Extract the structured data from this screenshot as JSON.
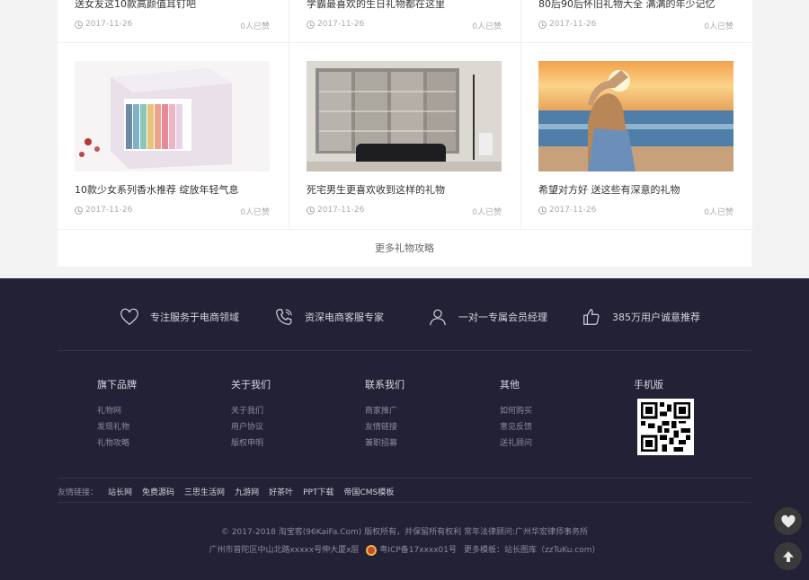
{
  "top_row": [
    {
      "title": "送女友这10款高颜值耳钉吧",
      "date": "2017-11-26",
      "likes": "0人已赞"
    },
    {
      "title": "学霸最喜欢的生日礼物都在这里",
      "date": "2017-11-26",
      "likes": "0人已赞"
    },
    {
      "title": "80后90后怀旧礼物大全 满满的年少记忆",
      "date": "2017-11-26",
      "likes": "0人已赞"
    }
  ],
  "cards": [
    {
      "title": "10款少女系列香水推荐 绽放年轻气息",
      "date": "2017-11-26",
      "likes": "0人已赞"
    },
    {
      "title": "死宅男生更喜欢收到这样的礼物",
      "date": "2017-11-26",
      "likes": "0人已赞"
    },
    {
      "title": "希望对方好 送这些有深意的礼物",
      "date": "2017-11-26",
      "likes": "0人已赞"
    }
  ],
  "more_label": "更多礼物攻略",
  "features": [
    {
      "icon": "heart-icon",
      "label": "专注服务于电商领域"
    },
    {
      "icon": "phone-icon",
      "label": "资深电商客服专家"
    },
    {
      "icon": "user-icon",
      "label": "一对一专属会员经理"
    },
    {
      "icon": "thumbs-up-icon",
      "label": "385万用户诚意推荐"
    }
  ],
  "columns": [
    {
      "head": "旗下品牌",
      "links": [
        "礼物网",
        "发现礼物",
        "礼物攻略"
      ]
    },
    {
      "head": "关于我们",
      "links": [
        "关于我们",
        "用户协议",
        "版权申明"
      ]
    },
    {
      "head": "联系我们",
      "links": [
        "商家推广",
        "友情链接",
        "兼职招募"
      ]
    },
    {
      "head": "其他",
      "links": [
        "如何购买",
        "意见反馈",
        "送礼顾问"
      ]
    },
    {
      "head": "手机版",
      "links": []
    }
  ],
  "friends_label": "友情链接：",
  "friend_links": [
    "站长网",
    "免费源码",
    "三思生活网",
    "九游网",
    "好茶叶",
    "PPT下载",
    "帝国CMS模板"
  ],
  "copyright": "© 2017-2018 淘宝客(96KaiFa.Com) 版权所有，并保留所有权利   常年法律顾问:广州华宏律师事务所",
  "address": "广州市普陀区中山北路xxxxx号伸大厦x层",
  "icp": "粤ICP备17xxxx01号",
  "more_templates": "更多模板：站长图库（zzTuKu.com）",
  "colors": {
    "footer_bg": "#232136",
    "page_bg": "#f3f3f3"
  }
}
